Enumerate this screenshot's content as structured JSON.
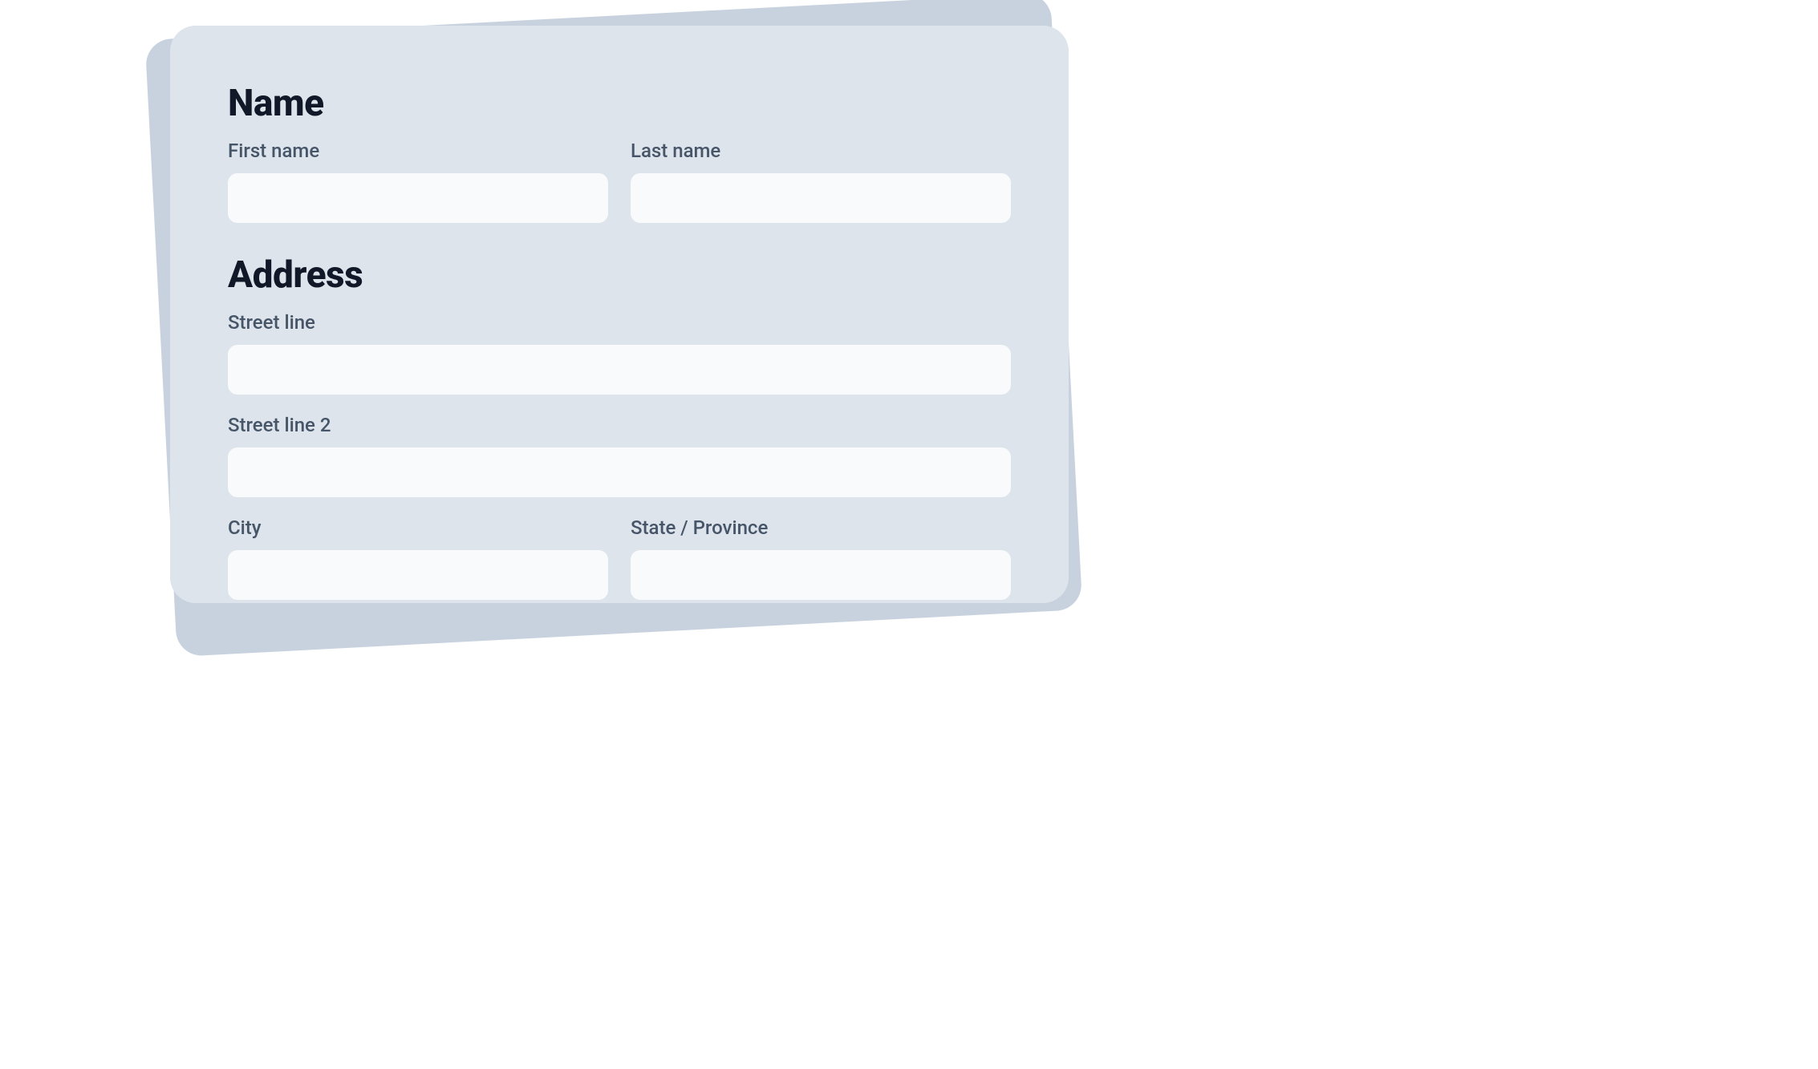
{
  "sections": {
    "name": {
      "heading": "Name",
      "first_name_label": "First name",
      "first_name_value": "",
      "last_name_label": "Last name",
      "last_name_value": ""
    },
    "address": {
      "heading": "Address",
      "street1_label": "Street line",
      "street1_value": "",
      "street2_label": "Street line 2",
      "street2_value": "",
      "city_label": "City",
      "city_value": "",
      "state_label": "State / Province",
      "state_value": ""
    }
  }
}
